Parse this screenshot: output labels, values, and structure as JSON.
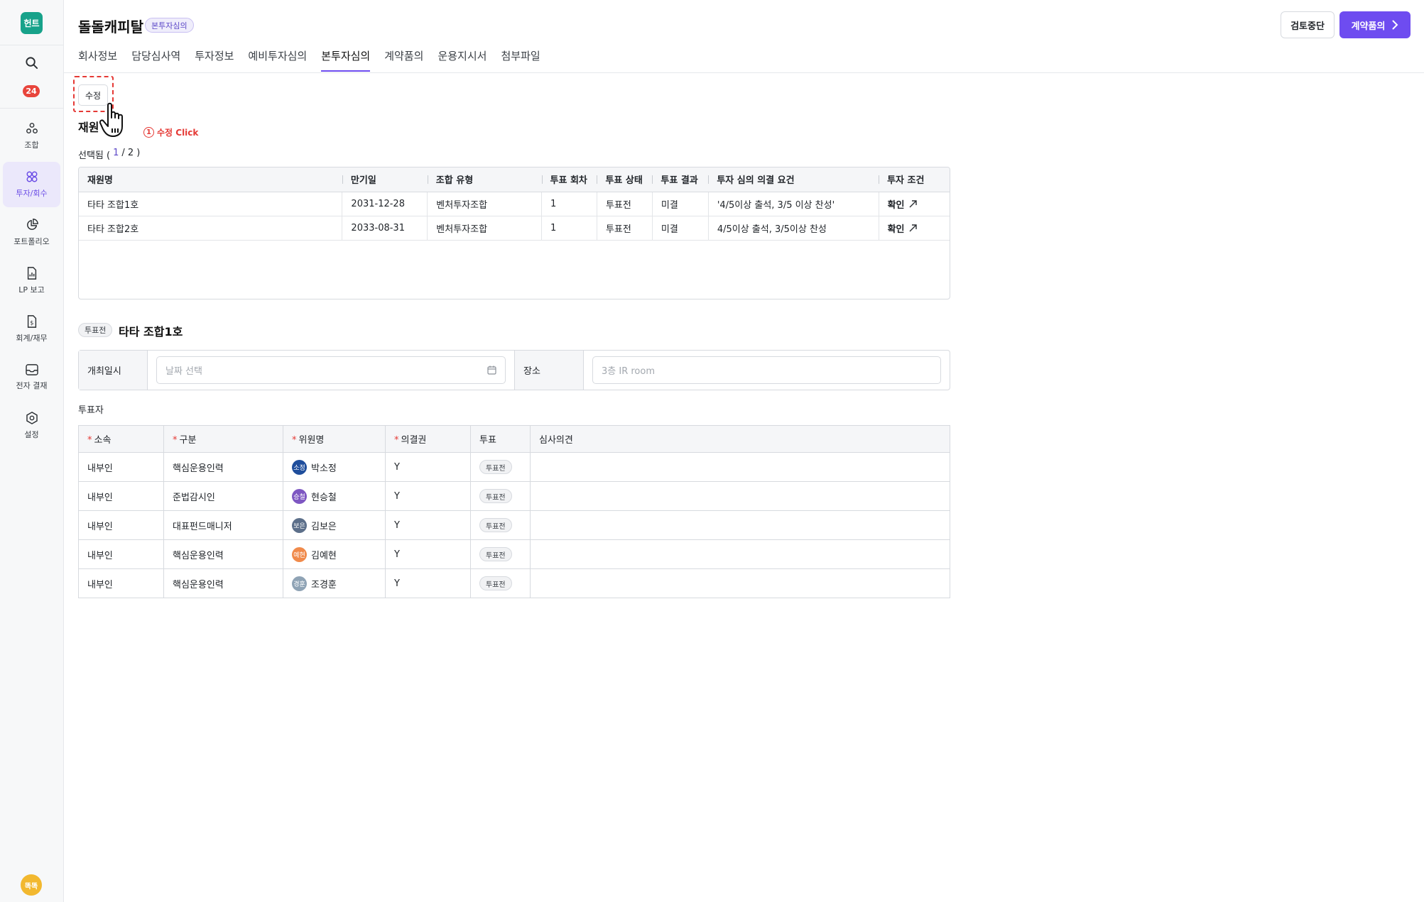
{
  "sidebar": {
    "logo": "헌트",
    "notif_count": "24",
    "items": [
      {
        "label": "조합",
        "icon": "fund-icon"
      },
      {
        "label": "투자/회수",
        "icon": "invest-icon"
      },
      {
        "label": "포트폴리오",
        "icon": "pie-chart-icon"
      },
      {
        "label": "LP 보고",
        "icon": "report-icon"
      },
      {
        "label": "회계/재무",
        "icon": "accounting-icon"
      },
      {
        "label": "전자 결재",
        "icon": "inbox-icon"
      },
      {
        "label": "설정",
        "icon": "gear-icon"
      }
    ],
    "active_index": 1,
    "user_avatar": "똑똑"
  },
  "header": {
    "title": "돌돌캐피탈",
    "status_chip": "본투자심의",
    "stop_button": "검토중단",
    "contract_button": "계약품의"
  },
  "tabs": [
    "회사정보",
    "담당심사역",
    "투자정보",
    "예비투자심의",
    "본투자심의",
    "계약품의",
    "운용지시서",
    "첨부파일"
  ],
  "active_tab": 4,
  "edit_button": "수정",
  "annotation": {
    "number": "1",
    "text": "수정 Click"
  },
  "section_title": "재원",
  "selected": {
    "prefix": "선택됨 (",
    "current": "1",
    "separator": "/ 2 )"
  },
  "fund_table": {
    "headers": [
      "재원명",
      "만기일",
      "조합 유형",
      "투표 회차",
      "투표 상태",
      "투표 결과",
      "투자 심의 의결 요건",
      "투자 조건"
    ],
    "rows": [
      [
        "타타 조합1호",
        "2031-12-28",
        "벤처투자조합",
        "1",
        "투표전",
        "미결",
        "'4/5이상 출석, 3/5 이상 찬성'",
        "확인"
      ],
      [
        "타타 조합2호",
        "2033-08-31",
        "벤처투자조합",
        "1",
        "투표전",
        "미결",
        "4/5이상 출석, 3/5이상 찬성",
        "확인"
      ]
    ]
  },
  "vote_section": {
    "chip": "투표전",
    "fund_name": "타타 조합1호",
    "date_label": "개최일시",
    "date_placeholder": "날짜 선택",
    "place_label": "장소",
    "place_placeholder": "3층 IR room"
  },
  "voters": {
    "label": "투표자",
    "headers": [
      "소속",
      "구분",
      "위원명",
      "의결권",
      "투표",
      "심사의견"
    ],
    "rows": [
      {
        "org": "내부인",
        "type": "핵심운용인력",
        "avatar": "소정",
        "avatar_color": "#1f4e9c",
        "name": "박소정",
        "vote_right": "Y",
        "vote": "투표전",
        "opinion": ""
      },
      {
        "org": "내부인",
        "type": "준법감시인",
        "avatar": "승철",
        "avatar_color": "#7e57c2",
        "name": "현승철",
        "vote_right": "Y",
        "vote": "투표전",
        "opinion": ""
      },
      {
        "org": "내부인",
        "type": "대표펀드매니저",
        "avatar": "보은",
        "avatar_color": "#5c6f8a",
        "name": "김보은",
        "vote_right": "Y",
        "vote": "투표전",
        "opinion": ""
      },
      {
        "org": "내부인",
        "type": "핵심운용인력",
        "avatar": "예현",
        "avatar_color": "#f08a4b",
        "name": "김예현",
        "vote_right": "Y",
        "vote": "투표전",
        "opinion": ""
      },
      {
        "org": "내부인",
        "type": "핵심운용인력",
        "avatar": "경훈",
        "avatar_color": "#8fa3b5",
        "name": "조경훈",
        "vote_right": "Y",
        "vote": "투표전",
        "opinion": ""
      }
    ]
  }
}
